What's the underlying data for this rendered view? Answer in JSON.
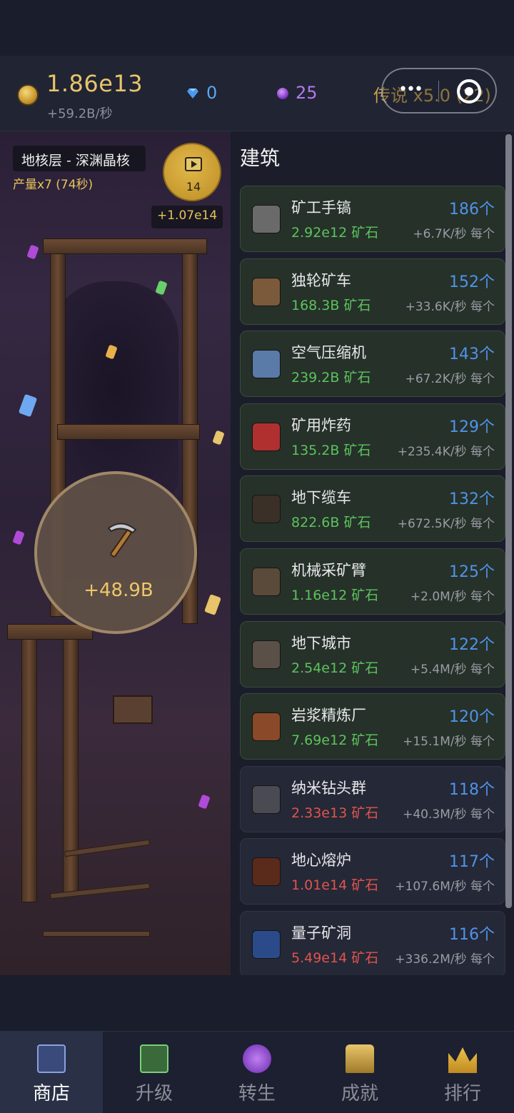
{
  "header": {
    "gold_amount": "1.86e13",
    "gold_rate": "+59.2B/秒",
    "diamonds": "0",
    "orbs": "25",
    "legend_text": "传说 x5.0 (22)",
    "capsule_dots": "•••"
  },
  "mine": {
    "layer_name": "地核层 - 深渊晶核",
    "production": "产量x7 (74秒)",
    "ad_count": "14",
    "ad_reward": "+1.07e14",
    "click_gain": "+48.9B"
  },
  "buildings": {
    "title": "建筑",
    "items": [
      {
        "name": "矿工手镐",
        "cost": "2.92e12 矿石",
        "count": "186个",
        "rate": "+6.7K/秒 每个",
        "affordable": true,
        "icon": "pickaxe-icon"
      },
      {
        "name": "独轮矿车",
        "cost": "168.3B 矿石",
        "count": "152个",
        "rate": "+33.6K/秒 每个",
        "affordable": true,
        "icon": "wheelbarrow-icon"
      },
      {
        "name": "空气压缩机",
        "cost": "239.2B 矿石",
        "count": "143个",
        "rate": "+67.2K/秒 每个",
        "affordable": true,
        "icon": "compressor-icon"
      },
      {
        "name": "矿用炸药",
        "cost": "135.2B 矿石",
        "count": "129个",
        "rate": "+235.4K/秒 每个",
        "affordable": true,
        "icon": "dynamite-icon"
      },
      {
        "name": "地下缆车",
        "cost": "822.6B 矿石",
        "count": "132个",
        "rate": "+672.5K/秒 每个",
        "affordable": true,
        "icon": "cable-car-icon"
      },
      {
        "name": "机械采矿臂",
        "cost": "1.16e12 矿石",
        "count": "125个",
        "rate": "+2.0M/秒 每个",
        "affordable": true,
        "icon": "robot-arm-icon"
      },
      {
        "name": "地下城市",
        "cost": "2.54e12 矿石",
        "count": "122个",
        "rate": "+5.4M/秒 每个",
        "affordable": true,
        "icon": "city-icon"
      },
      {
        "name": "岩浆精炼厂",
        "cost": "7.69e12 矿石",
        "count": "120个",
        "rate": "+15.1M/秒 每个",
        "affordable": true,
        "icon": "refinery-icon"
      },
      {
        "name": "纳米钻头群",
        "cost": "2.33e13 矿石",
        "count": "118个",
        "rate": "+40.3M/秒 每个",
        "affordable": false,
        "icon": "drill-swarm-icon"
      },
      {
        "name": "地心熔炉",
        "cost": "1.01e14 矿石",
        "count": "117个",
        "rate": "+107.6M/秒 每个",
        "affordable": false,
        "icon": "furnace-icon"
      },
      {
        "name": "量子矿洞",
        "cost": "5.49e14 矿石",
        "count": "116个",
        "rate": "+336.2M/秒 每个",
        "affordable": false,
        "icon": "portal-icon"
      }
    ]
  },
  "tabs": [
    {
      "label": "商店",
      "icon": "shop-cart-icon",
      "active": true
    },
    {
      "label": "升级",
      "icon": "upgrade-arrow-icon",
      "active": false
    },
    {
      "label": "转生",
      "icon": "crystal-ball-icon",
      "active": false
    },
    {
      "label": "成就",
      "icon": "trophy-icon",
      "active": false
    },
    {
      "label": "排行",
      "icon": "crown-icon",
      "active": false
    }
  ],
  "colors": {
    "gold": "#e8c46a",
    "affordable": "#5cc35c",
    "unaffordable": "#e0544c",
    "count_blue": "#4f93e8"
  }
}
